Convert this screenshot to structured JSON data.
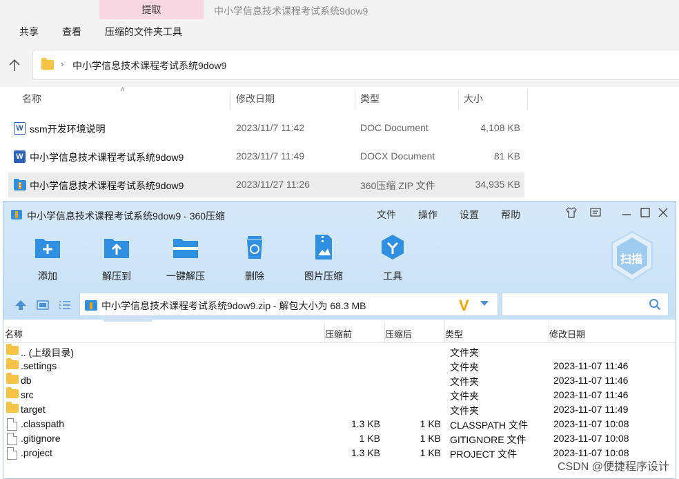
{
  "explorer": {
    "tab_extract": "提取",
    "window_title": "中小学信息技术课程考试系统9dow9",
    "ribbon_tabs": [
      "共享",
      "查看",
      "压缩的文件夹工具"
    ],
    "address_path": "中小学信息技术课程考试系统9dow9",
    "columns": {
      "name": "名称",
      "date": "修改日期",
      "type": "类型",
      "size": "大小"
    },
    "files": [
      {
        "name": "ssm开发环境说明",
        "date": "2023/11/7 11:42",
        "type": "DOC Document",
        "size": "4,108 KB",
        "icon": "word-doc-icon"
      },
      {
        "name": "中小学信息技术课程考试系统9dow9",
        "date": "2023/11/7 11:49",
        "type": "DOCX Document",
        "size": "81 KB",
        "icon": "word-docx-icon"
      },
      {
        "name": "中小学信息技术课程考试系统9dow9",
        "date": "2023/11/27 11:26",
        "type": "360压缩 ZIP 文件",
        "size": "34,935 KB",
        "icon": "zip-icon"
      }
    ]
  },
  "zipwin": {
    "title": "中小学信息技术课程考试系统9dow9 - 360压缩",
    "menus": [
      "文件",
      "操作",
      "设置",
      "帮助"
    ],
    "tools": [
      {
        "label": "添加",
        "icon": "add-icon"
      },
      {
        "label": "解压到",
        "icon": "extract-to-icon"
      },
      {
        "label": "一键解压",
        "icon": "one-click-extract-icon"
      },
      {
        "label": "删除",
        "icon": "delete-icon"
      },
      {
        "label": "图片压缩",
        "icon": "image-compress-icon"
      },
      {
        "label": "工具",
        "icon": "tools-icon"
      }
    ],
    "scan_label": "扫描",
    "path_text": "中小学信息技术课程考试系统9dow9.zip - 解包大小为 68.3 MB",
    "columns": {
      "name": "名称",
      "before": "压缩前",
      "after": "压缩后",
      "type": "类型",
      "date": "修改日期"
    },
    "rows": [
      {
        "name": ".. (上级目录)",
        "before": "",
        "after": "",
        "type": "文件夹",
        "date": "",
        "kind": "folder"
      },
      {
        "name": ".settings",
        "before": "",
        "after": "",
        "type": "文件夹",
        "date": "2023-11-07 11:46",
        "kind": "folder"
      },
      {
        "name": "db",
        "before": "",
        "after": "",
        "type": "文件夹",
        "date": "2023-11-07 11:46",
        "kind": "folder"
      },
      {
        "name": "src",
        "before": "",
        "after": "",
        "type": "文件夹",
        "date": "2023-11-07 11:46",
        "kind": "folder"
      },
      {
        "name": "target",
        "before": "",
        "after": "",
        "type": "文件夹",
        "date": "2023-11-07 11:49",
        "kind": "folder"
      },
      {
        "name": ".classpath",
        "before": "1.3 KB",
        "after": "1 KB",
        "type": "CLASSPATH 文件",
        "date": "2023-11-07 10:08",
        "kind": "file"
      },
      {
        "name": ".gitignore",
        "before": "1 KB",
        "after": "1 KB",
        "type": "GITIGNORE 文件",
        "date": "2023-11-07 10:08",
        "kind": "file"
      },
      {
        "name": ".project",
        "before": "1.3 KB",
        "after": "1 KB",
        "type": "PROJECT 文件",
        "date": "2023-11-07 10:08",
        "kind": "file"
      }
    ]
  },
  "watermark": "CSDN @便捷程序设计",
  "colors": {
    "accent_blue": "#2f8fe0",
    "folder_yellow": "#f6c344",
    "tab_pink": "#f8d7e3",
    "header_blue": "#c6e0f6"
  }
}
